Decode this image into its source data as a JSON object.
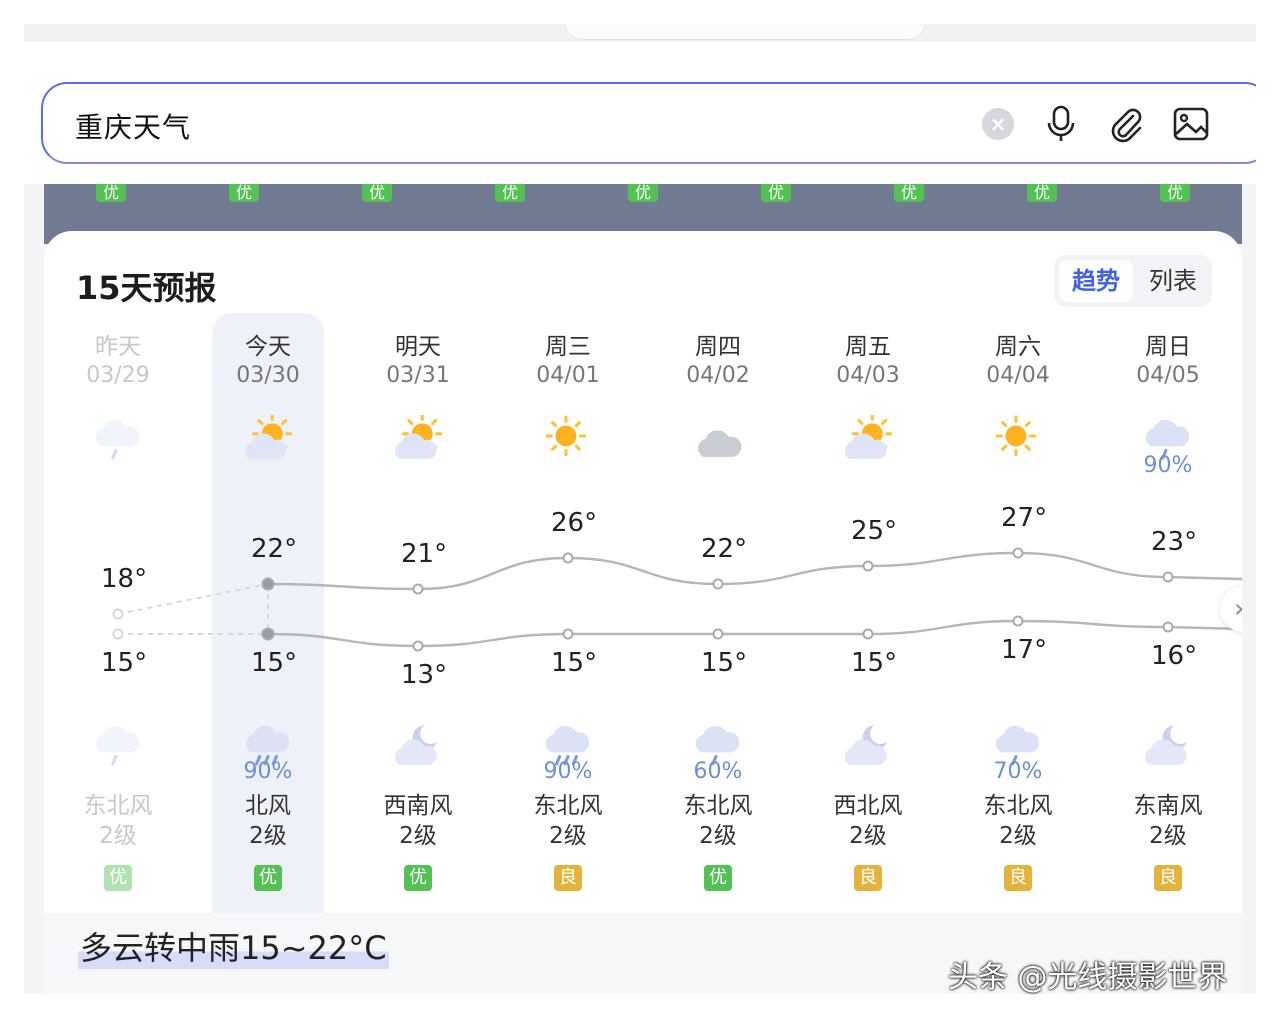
{
  "search": {
    "query": "重庆天气"
  },
  "top_aqi": [
    "优",
    "优",
    "优",
    "优",
    "优",
    "优",
    "优",
    "优",
    "优"
  ],
  "forecast": {
    "title": "15天预报",
    "toggle": {
      "trend": "趋势",
      "list": "列表"
    },
    "days": [
      {
        "week": "昨天",
        "date": "03/29",
        "high": "18°",
        "low": "15°",
        "day_icon": "cloud-drizzle-icon",
        "day_precip": "",
        "night_icon": "cloud-drizzle-icon",
        "night_precip": "",
        "wind_dir": "东北风",
        "wind_level": "2级",
        "aqi": "优",
        "aqi_color": "#54c154",
        "past": true
      },
      {
        "week": "今天",
        "date": "03/30",
        "high": "22°",
        "low": "15°",
        "day_icon": "partly-cloudy-day-icon",
        "day_precip": "",
        "night_icon": "cloud-heavy-rain-icon",
        "night_precip": "90%",
        "wind_dir": "北风",
        "wind_level": "2级",
        "aqi": "优",
        "aqi_color": "#54c154",
        "past": false
      },
      {
        "week": "明天",
        "date": "03/31",
        "high": "21°",
        "low": "13°",
        "day_icon": "partly-cloudy-day-icon",
        "day_precip": "",
        "night_icon": "partly-cloudy-night-icon",
        "night_precip": "",
        "wind_dir": "西南风",
        "wind_level": "2级",
        "aqi": "优",
        "aqi_color": "#54c154",
        "past": false
      },
      {
        "week": "周三",
        "date": "04/01",
        "high": "26°",
        "low": "15°",
        "day_icon": "sunny-icon",
        "day_precip": "",
        "night_icon": "cloud-heavy-rain-icon",
        "night_precip": "90%",
        "wind_dir": "东北风",
        "wind_level": "2级",
        "aqi": "良",
        "aqi_color": "#e3b43b",
        "past": false
      },
      {
        "week": "周四",
        "date": "04/02",
        "high": "22°",
        "low": "15°",
        "day_icon": "cloudy-icon",
        "day_precip": "",
        "night_icon": "cloud-drizzle-icon",
        "night_precip": "60%",
        "wind_dir": "东北风",
        "wind_level": "2级",
        "aqi": "优",
        "aqi_color": "#54c154",
        "past": false
      },
      {
        "week": "周五",
        "date": "04/03",
        "high": "25°",
        "low": "15°",
        "day_icon": "partly-cloudy-day-icon",
        "day_precip": "",
        "night_icon": "partly-cloudy-night-icon",
        "night_precip": "",
        "wind_dir": "西北风",
        "wind_level": "2级",
        "aqi": "良",
        "aqi_color": "#e3b43b",
        "past": false
      },
      {
        "week": "周六",
        "date": "04/04",
        "high": "27°",
        "low": "17°",
        "day_icon": "sunny-icon",
        "day_precip": "",
        "night_icon": "cloud-drizzle-icon",
        "night_precip": "70%",
        "wind_dir": "东北风",
        "wind_level": "2级",
        "aqi": "良",
        "aqi_color": "#e3b43b",
        "past": false
      },
      {
        "week": "周日",
        "date": "04/05",
        "high": "23°",
        "low": "16°",
        "day_icon": "cloud-drizzle-icon",
        "day_precip": "90%",
        "night_icon": "partly-cloudy-night-icon",
        "night_precip": "",
        "wind_dir": "东南风",
        "wind_level": "2级",
        "aqi": "良",
        "aqi_color": "#e3b43b",
        "past": false
      }
    ]
  },
  "summary": "多云转中雨15~22°C",
  "watermark": "头条 @光线摄影世界"
}
